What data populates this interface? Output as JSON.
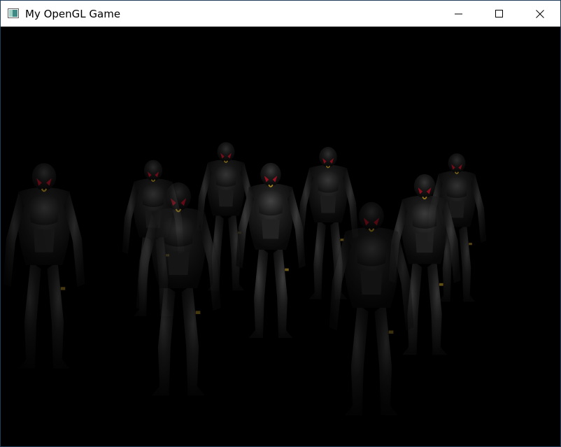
{
  "window": {
    "title": "My OpenGL Game",
    "controls": [
      "minimize",
      "maximize",
      "close"
    ]
  },
  "scene": {
    "background": "#000000",
    "icons": {
      "app": "opengl-window-icon",
      "minimize": "minimize-icon",
      "maximize": "maximize-icon",
      "close": "close-icon"
    },
    "colors": {
      "suit_dark": "#101010",
      "suit_mid": "#2a2a2a",
      "suit_highlight": "#4a4a4a",
      "visor_red": "#c2152a",
      "accent_gold": "#caa22c"
    },
    "characters": [
      "soldier-1",
      "soldier-2",
      "soldier-3",
      "soldier-4",
      "soldier-5",
      "soldier-6",
      "soldier-7",
      "soldier-8",
      "soldier-9"
    ]
  }
}
